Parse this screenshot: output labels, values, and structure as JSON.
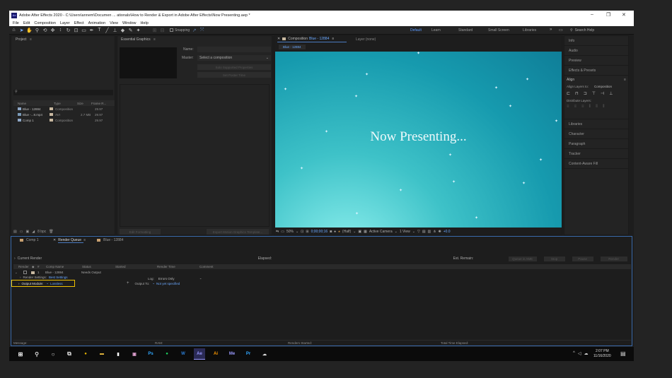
{
  "window": {
    "title": "Adobe After Effects 2020 - C:\\Users\\annem\\Documen ... ationals\\How to Render & Export in Adobe After Effects\\Now Presenting.aep *",
    "logo": "Ae"
  },
  "menu": [
    "File",
    "Edit",
    "Composition",
    "Layer",
    "Effect",
    "Animation",
    "View",
    "Window",
    "Help"
  ],
  "toolbar": {
    "snapping_label": "Snapping",
    "workspaces": [
      "Default",
      "Learn",
      "Standard",
      "Small Screen",
      "Libraries"
    ],
    "search_placeholder": "Search Help"
  },
  "project": {
    "title": "Project",
    "search_placeholder": "",
    "columns": [
      "Name",
      "Type",
      "Size",
      "Frame R..."
    ],
    "items": [
      {
        "name": "Blue - 12884",
        "type": "Composition",
        "size": "",
        "fps": "29.97"
      },
      {
        "name": "Blue -...8.mp4",
        "type": "AVI",
        "size": "2.7 MB",
        "fps": "29.97"
      },
      {
        "name": "Comp 1",
        "type": "Composition",
        "size": "",
        "fps": "29.97"
      }
    ],
    "bpc": "8 bpc"
  },
  "essential_graphics": {
    "title": "Essential Graphics",
    "name_label": "Name:",
    "master_label": "Master:",
    "master_value": "Select a composition",
    "btn_add": "Solo Supported Properties",
    "btn_set": "Set Poster Time",
    "btn_edit": "Edit Formatting",
    "btn_export": "Export Motion Graphics Template..."
  },
  "viewer": {
    "tab": "Composition",
    "comp_name": "Blue - 12884",
    "layer_tab": "Layer (none)",
    "subtab": "Blue - 12884",
    "text": "Now Presenting...",
    "zoom": "50%",
    "timecode": "0;00;00;16",
    "resolution": "(Half)",
    "camera": "Active Camera",
    "view": "1 View",
    "exposure": "+0.0"
  },
  "right_panels": {
    "items_top": [
      "Info",
      "Audio",
      "Preview",
      "Effects & Presets"
    ],
    "align_title": "Align",
    "align_to_label": "Align Layers to:",
    "align_to_value": "Composition",
    "distribute_label": "Distribute Layers:",
    "items_bottom": [
      "Libraries",
      "Character",
      "Paragraph",
      "Tracker",
      "Content-Aware Fill"
    ]
  },
  "bottom": {
    "tabs": [
      "Comp 1",
      "Render Queue",
      "Blue - 12884"
    ],
    "current_render": "Current Render",
    "elapsed": "Elapsed:",
    "remain": "Est. Remain:",
    "buttons": [
      "Queue in AME",
      "Stop",
      "Pause",
      "Render"
    ],
    "cols": [
      "Render",
      "#",
      "Comp Name",
      "Status",
      "Started",
      "Render Time",
      "Comment"
    ],
    "row": {
      "num": "1",
      "comp": "Blue - 12884",
      "status": "Needs Output"
    },
    "render_settings_label": "Render Settings:",
    "render_settings_value": "Best Settings",
    "output_module_label": "Output Module:",
    "output_module_value": "Lossless",
    "log_label": "Log:",
    "log_value": "Errors Only",
    "output_to_label": "Output To:",
    "output_to_value": "Not yet specified",
    "footer": {
      "message": "Message:",
      "ram": "RAM:",
      "renders_started": "Renders Started:",
      "total_time": "Total Time Elapsed:"
    }
  },
  "taskbar": {
    "apps": [
      {
        "name": "chrome",
        "color": "#e8b400",
        "glyph": "●"
      },
      {
        "name": "file-explorer",
        "color": "#f0c040",
        "glyph": "▬"
      },
      {
        "name": "notepad",
        "color": "#ffffff",
        "glyph": "▮"
      },
      {
        "name": "photos",
        "color": "#e0a0d0",
        "glyph": "▣"
      },
      {
        "name": "photoshop",
        "color": "#31a8ff",
        "glyph": "Ps"
      },
      {
        "name": "spotify",
        "color": "#1ed760",
        "glyph": "●"
      },
      {
        "name": "word",
        "color": "#2b7cd3",
        "glyph": "W"
      },
      {
        "name": "after-effects",
        "color": "#9999ff",
        "glyph": "Ae"
      },
      {
        "name": "illustrator",
        "color": "#ff9a00",
        "glyph": "Ai"
      },
      {
        "name": "media-encoder",
        "color": "#9999ff",
        "glyph": "Me"
      },
      {
        "name": "premiere-rush",
        "color": "#31a8ff",
        "glyph": "Pr"
      },
      {
        "name": "cloud-app",
        "color": "#dddddd",
        "glyph": "☁"
      }
    ],
    "time": "2:07 PM",
    "date": "11/16/2020"
  }
}
